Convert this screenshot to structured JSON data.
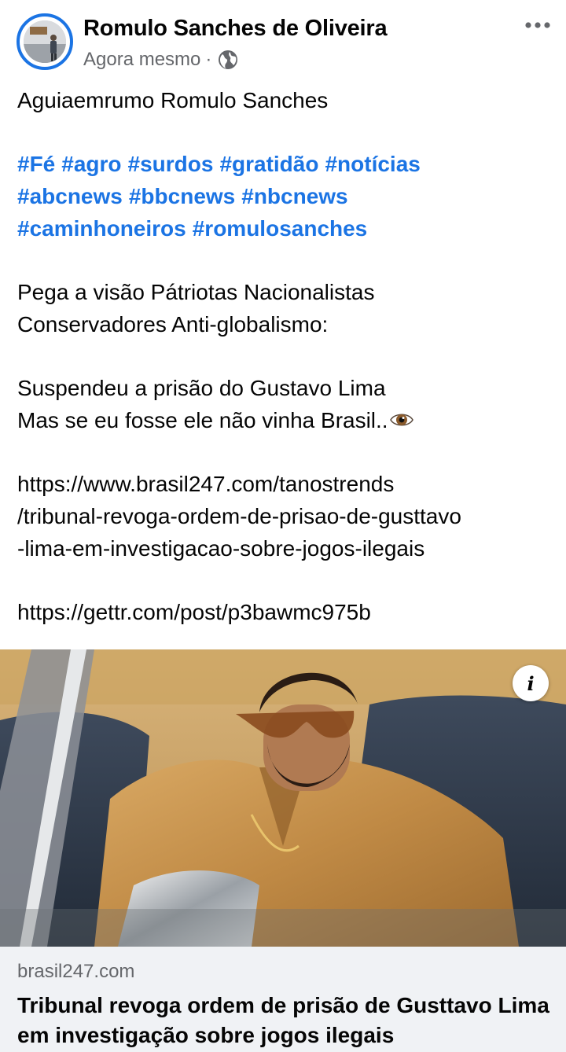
{
  "post": {
    "author": "Romulo Sanches de Oliveira",
    "timestamp": "Agora mesmo",
    "separator": "·",
    "privacy_icon": "globe-icon",
    "more_icon": "more-horizontal-icon",
    "intro": "Aguiaemrumo Romulo Sanches",
    "hashtags": [
      "#Fé",
      "#agro",
      "#surdos",
      "#gratidão",
      "#notícias",
      "#abcnews",
      "#bbcnews",
      "#nbcnews",
      "#caminhoneiros",
      "#romulosanches"
    ],
    "para2_line1": "Pega a visão Pátriotas Nacionalistas",
    "para2_line2": "Conservadores Anti-globalismo:",
    "para3_line1": "Suspendeu a prisão do Gustavo Lima",
    "para3_line2": "Mas se eu fosse ele não vinha Brasil..",
    "eye_emoji": "eye-emoji-icon",
    "link1_line1": "https://www.brasil247.com/tanostrends",
    "link1_line2": "/tribunal-revoga-ordem-de-prisao-de-gusttavo",
    "link1_line3": "-lima-em-investigacao-sobre-jogos-ilegais",
    "link2": "https://gettr.com/post/p3bawmc975b"
  },
  "link_preview": {
    "info_label": "i",
    "domain": "brasil247.com",
    "headline": "Tribunal revoga ordem de prisão de Gusttavo Lima em investigação sobre jogos ilegais"
  },
  "colors": {
    "accent": "#1b74e4",
    "text": "#050505",
    "secondary_text": "#65676b",
    "card_bg": "#f0f2f5"
  }
}
